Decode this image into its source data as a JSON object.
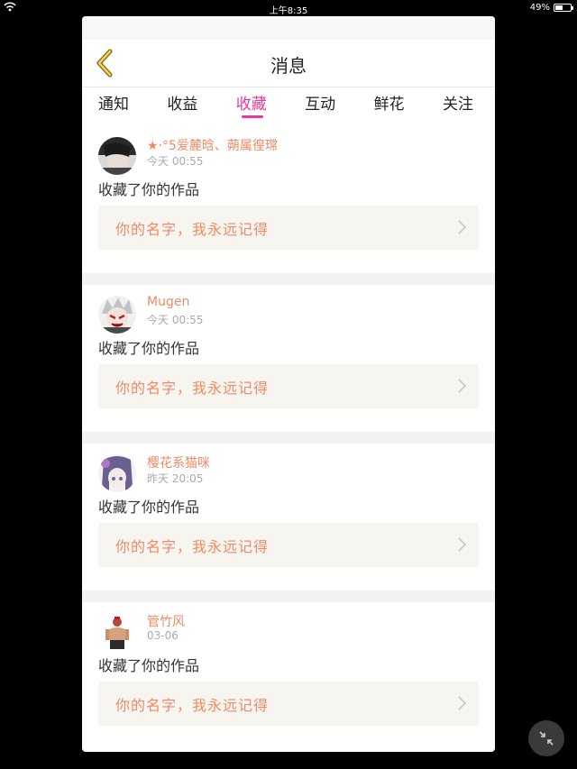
{
  "statusbar": {
    "time": "上午8:35",
    "battery": "49%",
    "battery_level": 0.49
  },
  "header": {
    "title": "消息"
  },
  "tabs": [
    {
      "label": "通知"
    },
    {
      "label": "收益"
    },
    {
      "label": "收藏"
    },
    {
      "label": "互动"
    },
    {
      "label": "鲜花"
    },
    {
      "label": "关注"
    }
  ],
  "messages": [
    {
      "user": "★·°5爱麓晗、蒴属徨瑺",
      "time": "今天 00:55",
      "action": "收藏了你的作品",
      "work": "你的名字，我永远记得"
    },
    {
      "user": "Mugen",
      "time": "今天 00:55",
      "action": "收藏了你的作品",
      "work": "你的名字，我永远记得"
    },
    {
      "user": "樱花系猫咪",
      "time": "昨天 20:05",
      "action": "收藏了你的作品",
      "work": "你的名字，我永远记得"
    },
    {
      "user": "管竹风",
      "time": "03-06",
      "action": "收藏了你的作品",
      "work": "你的名字，我永远记得"
    }
  ],
  "colors": {
    "accent": "#e6399b",
    "name": "#ee8b66",
    "work_bg": "#f6f5ef"
  },
  "icons": {
    "back": "chevron-left-icon",
    "open": "chevron-right-icon",
    "collapse": "collapse-icon",
    "wifi": "wifi-icon",
    "battery": "battery-icon"
  }
}
